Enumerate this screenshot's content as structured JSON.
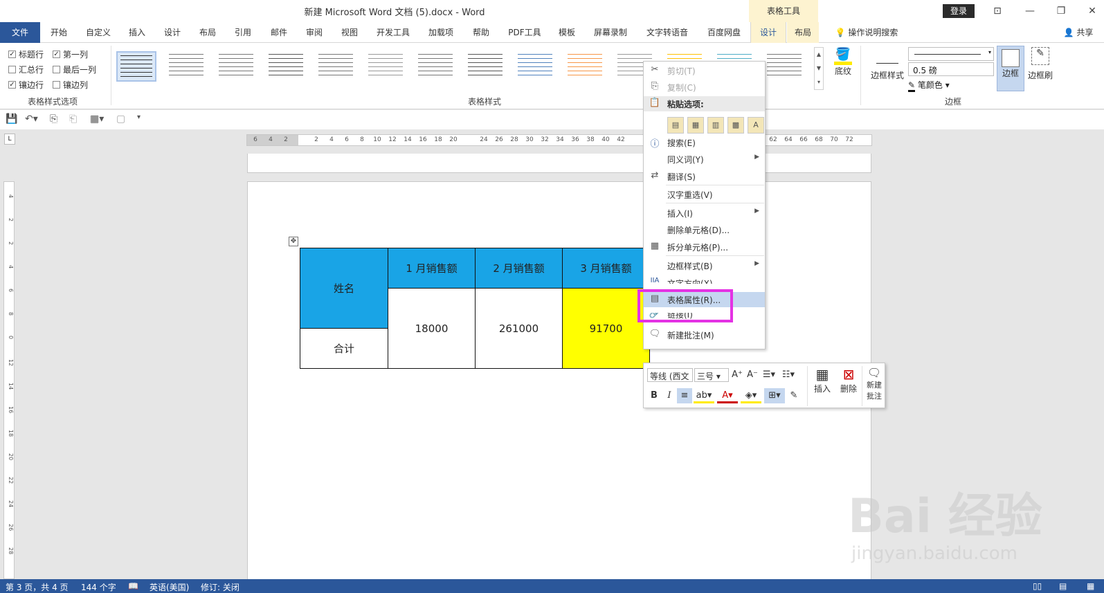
{
  "titlebar": {
    "doc_title": "新建 Microsoft Word 文档 (5).docx  -  Word",
    "context_tab": "表格工具",
    "login": "登录",
    "min": "—",
    "restore": "❐",
    "close": "✕",
    "ribbon_display": "⊡"
  },
  "menu": {
    "file": "文件",
    "items": [
      "开始",
      "自定义",
      "插入",
      "设计",
      "布局",
      "引用",
      "邮件",
      "审阅",
      "视图",
      "开发工具",
      "加载项",
      "帮助",
      "PDF工具",
      "模板",
      "屏幕录制",
      "文字转语音",
      "百度网盘"
    ],
    "ctx_design": "设计",
    "ctx_layout": "布局",
    "tell_me": "操作说明搜索",
    "share": "共享"
  },
  "ribbon": {
    "options": [
      {
        "label": "标题行",
        "checked": true
      },
      {
        "label": "第一列",
        "checked": true
      },
      {
        "label": "汇总行",
        "checked": false
      },
      {
        "label": "最后一列",
        "checked": false
      },
      {
        "label": "镶边行",
        "checked": true
      },
      {
        "label": "镶边列",
        "checked": false
      }
    ],
    "group_options_label": "表格样式选项",
    "group_styles_label": "表格样式",
    "shading": "底纹",
    "border_styles": "边框样式",
    "pen_weight": "0.5 磅",
    "pen_color": "笔颜色",
    "borders": "边框",
    "border_painter": "边框刷",
    "group_borders_label": "边框"
  },
  "ruler": {
    "h_numbers": [
      "6",
      "4",
      "2",
      "2",
      "4",
      "6",
      "8",
      "10",
      "12",
      "14",
      "16",
      "18",
      "20",
      "24",
      "26",
      "28",
      "30",
      "32",
      "34",
      "36",
      "38",
      "40",
      "42",
      "62",
      "64",
      "66",
      "68",
      "70",
      "72"
    ],
    "v_numbers": [
      "4",
      "2",
      "2",
      "4",
      "6",
      "8",
      "0",
      "12",
      "14",
      "16",
      "18",
      "20",
      "22",
      "24",
      "26",
      "28"
    ]
  },
  "table": {
    "header_name": "姓名",
    "months": [
      "1 月销售额",
      "2 月销售额",
      "3 月销售额"
    ],
    "total_label": "合计",
    "values": [
      "18000",
      "261000",
      "91700"
    ]
  },
  "context_menu": {
    "cut": "剪切(T)",
    "copy": "复制(C)",
    "paste_options": "粘贴选项:",
    "search": "搜索(E)",
    "synonyms": "同义词(Y)",
    "translate": "翻译(S)",
    "hanzi_reselect": "汉字重选(V)",
    "insert": "插入(I)",
    "delete_cells": "删除单元格(D)...",
    "split_cells": "拆分单元格(P)...",
    "border_styles": "边框样式(B)",
    "text_direction": "文字方向(X)...",
    "table_properties": "表格属性(R)...",
    "link": "链接(I)",
    "new_comment": "新建批注(M)"
  },
  "mini_toolbar": {
    "font": "等线 (西文",
    "size": "三号",
    "insert": "插入",
    "delete": "删除",
    "new_comment": "新建批注"
  },
  "status": {
    "page": "第 3 页，共 4 页",
    "words": "144 个字",
    "language": "英语(美国)",
    "track": "修订: 关闭"
  },
  "watermark": {
    "brand": "Bai 经验",
    "url": "jingyan.baidu.com"
  },
  "colors": {
    "accent": "#2b579a",
    "table_header": "#19a4e6",
    "highlight_cell": "#ffff00",
    "callout": "#e432e4"
  }
}
